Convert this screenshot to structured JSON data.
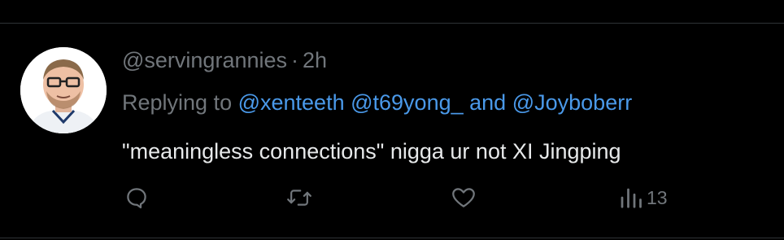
{
  "tweet": {
    "handle": "@servingrannies",
    "separator": "·",
    "time": "2h",
    "reply_prefix": "Replying to ",
    "mentions": [
      "@xenteeth",
      "@t69yong_",
      "@Joyboberr"
    ],
    "mention_joiner": "and",
    "text": "\"meaningless connections\" nigga ur not XI Jingping"
  },
  "actions": {
    "reply_icon": "reply-icon",
    "retweet_icon": "retweet-icon",
    "like_icon": "heart-icon",
    "views_icon": "views-icon",
    "views_count": "13"
  },
  "colors": {
    "background": "#000000",
    "text": "#e7e9ea",
    "muted": "#71767b",
    "mention": "#4a99e9",
    "divider": "#2f3336"
  }
}
